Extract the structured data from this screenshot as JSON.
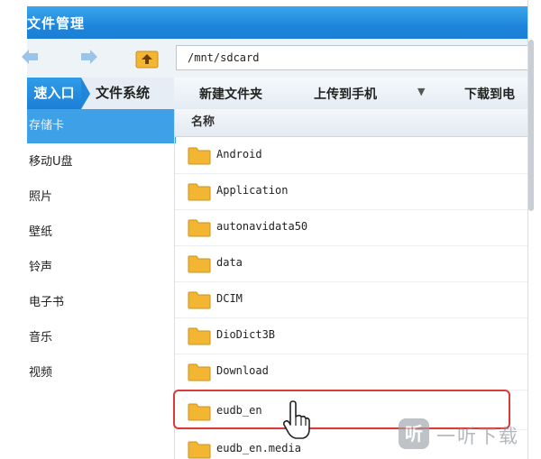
{
  "window": {
    "title": "文件管理"
  },
  "address": {
    "path": "/mnt/sdcard"
  },
  "tabs": {
    "quick": "速入口",
    "filesystem": "文件系统"
  },
  "toolbar": {
    "new_folder": "新建文件夹",
    "upload": "上传到手机",
    "upload_caret": "▼",
    "download": "下载到电"
  },
  "sidebar": {
    "items": [
      {
        "label": "存储卡",
        "active": true
      },
      {
        "label": "移动U盘"
      },
      {
        "label": "照片"
      },
      {
        "label": "壁纸"
      },
      {
        "label": "铃声"
      },
      {
        "label": "电子书"
      },
      {
        "label": "音乐"
      },
      {
        "label": "视频"
      }
    ]
  },
  "list": {
    "header": "名称",
    "rows": [
      {
        "name": "Android"
      },
      {
        "name": "Application"
      },
      {
        "name": "autonavidata50"
      },
      {
        "name": "data"
      },
      {
        "name": "DCIM"
      },
      {
        "name": "DioDict3B"
      },
      {
        "name": "Download"
      },
      {
        "name": "eudb_en",
        "highlighted": true
      },
      {
        "name": "eudb_en.media"
      }
    ]
  },
  "watermark": {
    "logo": "听",
    "text": "一听下载"
  },
  "colors": {
    "accent": "#1e86dd",
    "highlight_border": "#d93a3a",
    "folder": "#f2b632"
  },
  "icons": [
    "back-arrow-icon",
    "forward-arrow-icon",
    "up-folder-icon",
    "folder-icon",
    "hand-cursor-icon"
  ]
}
